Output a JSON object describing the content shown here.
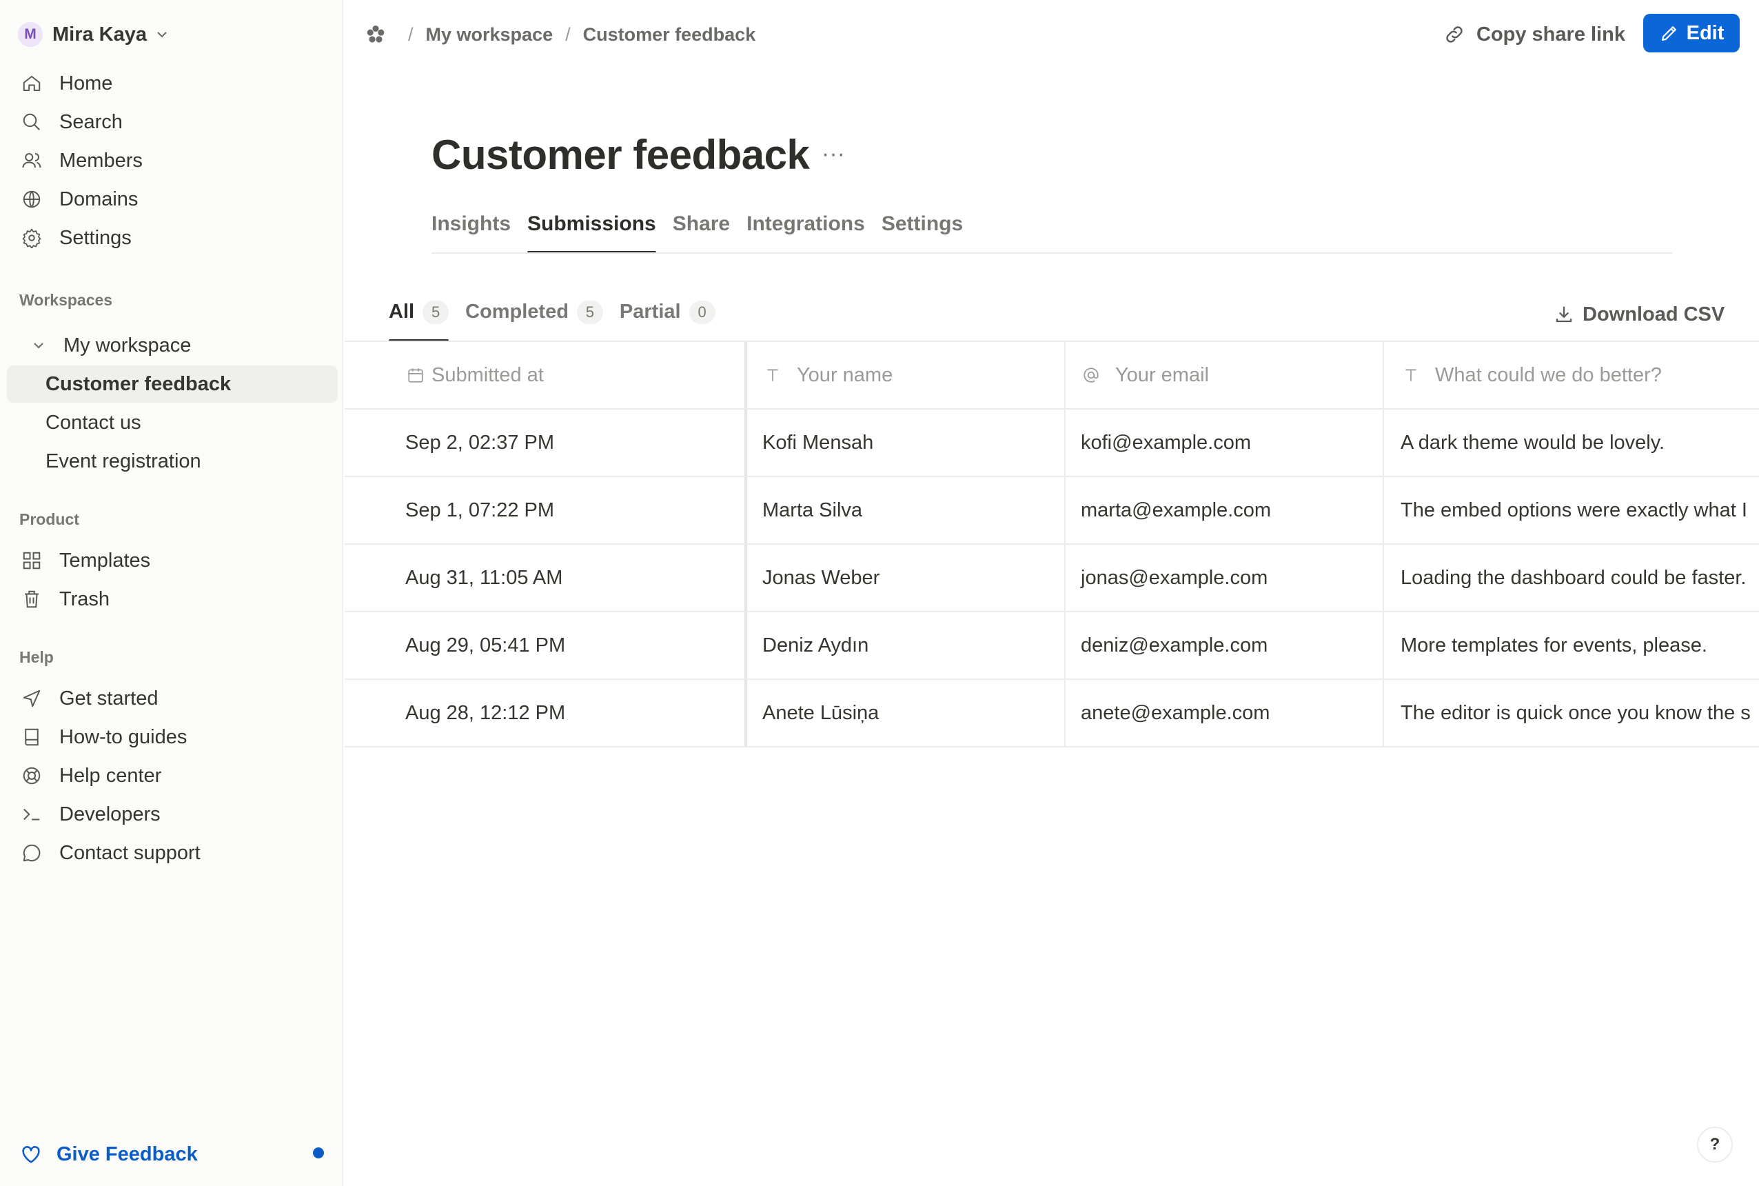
{
  "user": {
    "initial": "M",
    "name": "Mira Kaya"
  },
  "sidebar": {
    "nav": [
      {
        "label": "Home",
        "icon": "home-icon"
      },
      {
        "label": "Search",
        "icon": "search-icon"
      },
      {
        "label": "Members",
        "icon": "members-icon"
      },
      {
        "label": "Domains",
        "icon": "globe-icon"
      },
      {
        "label": "Settings",
        "icon": "gear-icon"
      }
    ],
    "workspaces_label": "Workspaces",
    "workspace_name": "My workspace",
    "forms": [
      "Customer feedback",
      "Contact us",
      "Event registration"
    ],
    "product_label": "Product",
    "product": [
      {
        "label": "Templates",
        "icon": "grid-icon"
      },
      {
        "label": "Trash",
        "icon": "trash-icon"
      }
    ],
    "help_label": "Help",
    "help": [
      {
        "label": "Get started",
        "icon": "send-icon"
      },
      {
        "label": "How-to guides",
        "icon": "book-icon"
      },
      {
        "label": "Help center",
        "icon": "lifebuoy-icon"
      },
      {
        "label": "Developers",
        "icon": "terminal-icon"
      },
      {
        "label": "Contact support",
        "icon": "chat-icon"
      }
    ],
    "give_feedback": "Give Feedback"
  },
  "header": {
    "breadcrumb": [
      "My workspace",
      "Customer feedback"
    ],
    "copy_share_link": "Copy share link",
    "edit": "Edit",
    "accent": "#0b66d8"
  },
  "main": {
    "title": "Customer feedback",
    "more": "···",
    "tabs": [
      "Insights",
      "Submissions",
      "Share",
      "Integrations",
      "Settings"
    ],
    "active_tab": "Submissions",
    "subtabs": [
      {
        "label": "All",
        "count": "5"
      },
      {
        "label": "Completed",
        "count": "5"
      },
      {
        "label": "Partial",
        "count": "0"
      }
    ],
    "download_csv": "Download CSV",
    "table": {
      "columns": [
        "Submitted at",
        "Your name",
        "Your email",
        "What could we do better?"
      ],
      "rows": [
        [
          "Sep 2, 02:37 PM",
          "Kofi Mensah",
          "kofi@example.com",
          "A dark theme would be lovely."
        ],
        [
          "Sep 1, 07:22 PM",
          "Marta Silva",
          "marta@example.com",
          "The embed options were exactly what I"
        ],
        [
          "Aug 31, 11:05 AM",
          "Jonas Weber",
          "jonas@example.com",
          "Loading the dashboard could be faster."
        ],
        [
          "Aug 29, 05:41 PM",
          "Deniz Aydın",
          "deniz@example.com",
          "More templates for events, please."
        ],
        [
          "Aug 28, 12:12 PM",
          "Anete Lūsiņa",
          "anete@example.com",
          "The editor is quick once you know the s"
        ]
      ]
    }
  },
  "help_button": "?"
}
